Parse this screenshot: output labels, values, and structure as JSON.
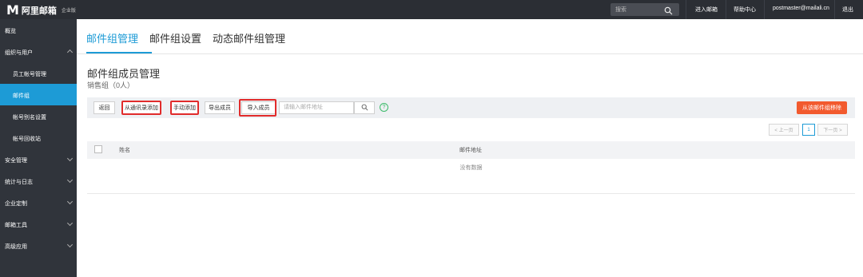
{
  "topbar": {
    "logo_letter": "M",
    "logo_text": "阿里邮箱",
    "logo_sub": "企业版",
    "search_placeholder": "搜索",
    "links": [
      "进入邮箱",
      "帮助中心",
      "postmaster@mailali.cn",
      "退出"
    ]
  },
  "sidebar": {
    "items": [
      {
        "label": "概览"
      },
      {
        "label": "组织与用户"
      },
      {
        "label": "员工帐号管理"
      },
      {
        "label": "邮件组"
      },
      {
        "label": "帐号别名设置"
      },
      {
        "label": "帐号回收站"
      },
      {
        "label": "安全管理"
      },
      {
        "label": "统计与日志"
      },
      {
        "label": "企业定制"
      },
      {
        "label": "邮箱工具"
      },
      {
        "label": "高级应用"
      }
    ]
  },
  "tabs": [
    "邮件组管理",
    "邮件组设置",
    "动态邮件组管理"
  ],
  "page": {
    "title": "邮件组成员管理",
    "subtitle": "销售组（0人）"
  },
  "toolbar": {
    "back": "返回",
    "add_from_contacts": "从通讯录添加",
    "manual_add": "手动添加",
    "export": "导出成员",
    "import": "导入成员",
    "email_placeholder": "请输入邮件地址",
    "help": "?",
    "remove": "从该邮件组移除"
  },
  "pager": {
    "prev": "< 上一页",
    "current": "1",
    "next": "下一页 >"
  },
  "table": {
    "col_name": "姓名",
    "col_email": "邮件地址",
    "empty": "没有数据"
  },
  "colors": {
    "accent": "#1d9bd6",
    "topbar": "#2b2e34",
    "sidebar": "#30343b",
    "danger": "#f25a2e",
    "highlight_box": "#e12b2b"
  }
}
